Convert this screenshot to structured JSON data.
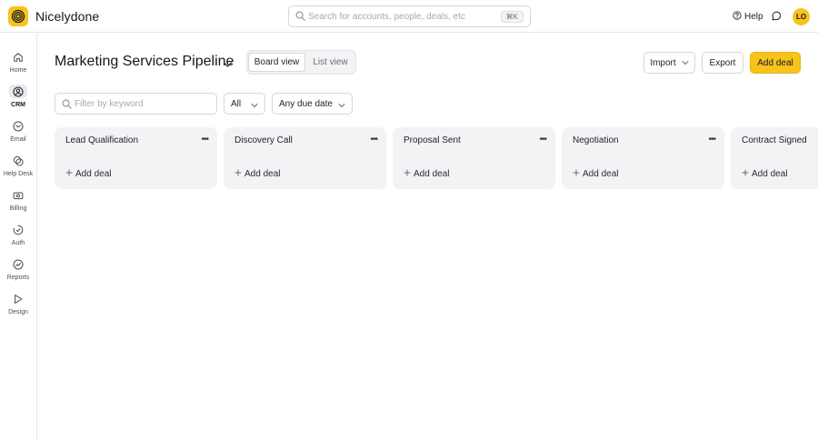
{
  "app": {
    "brand": "Nicelydone",
    "search_placeholder": "Search for accounts, people, deals, etc",
    "search_shortcut": "⌘K",
    "help_label": "Help",
    "avatar_initials": "LO",
    "accent_color": "#f7c31c"
  },
  "sidebar": {
    "items": [
      {
        "label": "Home",
        "icon": "home-icon"
      },
      {
        "label": "CRM",
        "icon": "crm-icon",
        "active": true
      },
      {
        "label": "Email",
        "icon": "email-icon"
      },
      {
        "label": "Help Desk",
        "icon": "help-desk-icon"
      },
      {
        "label": "Billing",
        "icon": "billing-icon"
      },
      {
        "label": "Auth",
        "icon": "auth-icon"
      },
      {
        "label": "Reports",
        "icon": "reports-icon"
      },
      {
        "label": "Design",
        "icon": "design-icon"
      }
    ]
  },
  "header": {
    "title": "Marketing Services Pipeline",
    "views": {
      "board": "Board view",
      "list": "List view",
      "active": "board"
    },
    "import_label": "Import",
    "export_label": "Export",
    "add_deal_label": "Add deal"
  },
  "filters": {
    "keyword_placeholder": "Filter by keyword",
    "owner_value": "All",
    "due_value": "Any due date"
  },
  "columns": [
    {
      "title": "Lead Qualification",
      "add_label": "Add deal"
    },
    {
      "title": "Discovery Call",
      "add_label": "Add deal"
    },
    {
      "title": "Proposal Sent",
      "add_label": "Add deal"
    },
    {
      "title": "Negotiation",
      "add_label": "Add deal"
    },
    {
      "title": "Contract Signed",
      "add_label": "Add deal"
    }
  ]
}
